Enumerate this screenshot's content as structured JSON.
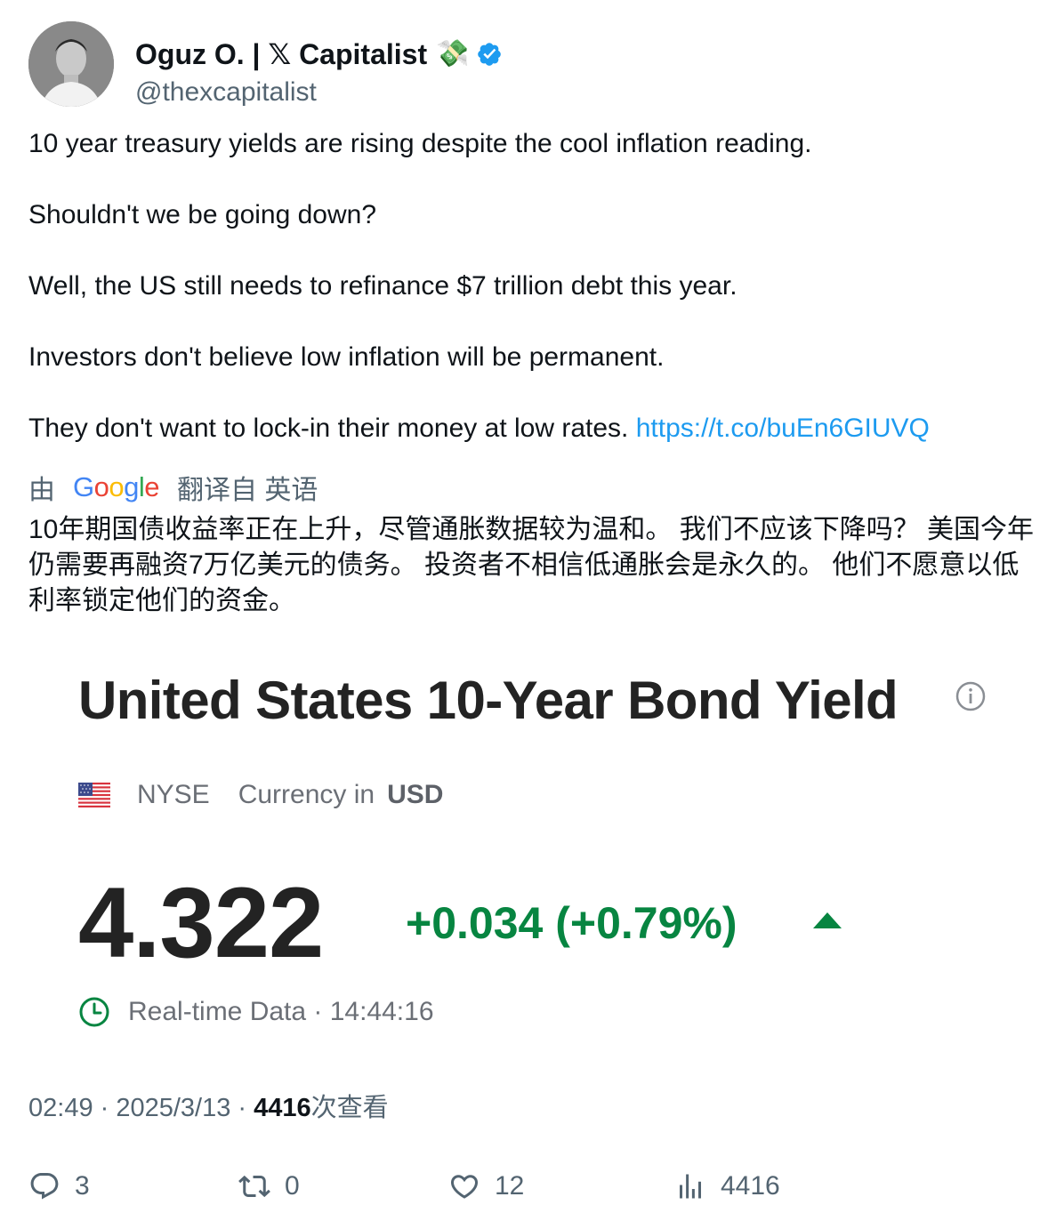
{
  "author": {
    "display_name": "Oguz O. | 𝕏 Capitalist",
    "emoji": "💸",
    "handle": "@thexcapitalist",
    "verified": true
  },
  "tweet": {
    "paragraphs": [
      "10 year treasury yields are rising despite the cool inflation reading.",
      "Shouldn't we be going down?",
      "Well, the US still needs to refinance $7 trillion debt this year.",
      "Investors don't believe low inflation will be permanent."
    ],
    "last_paragraph_text": "They don't want to lock-in their money at low rates.",
    "link": "https://t.co/buEn6GIUVQ"
  },
  "translation": {
    "prefix": "由",
    "provider": "Google",
    "suffix": "翻译自 英语",
    "text": "10年期国债收益率正在上升，尽管通胀数据较为温和。 我们不应该下降吗？ 美国今年仍需要再融资7万亿美元的债务。 投资者不相信低通胀会是永久的。 他们不愿意以低利率锁定他们的资金。"
  },
  "card": {
    "title": "United States 10-Year Bond Yield",
    "exchange": "NYSE",
    "currency_label": "Currency in",
    "currency": "USD",
    "price": "4.322",
    "change": "+0.034 (+0.79%)",
    "change_color": "#078541",
    "realtime_label": "Real-time Data · 14:44:16"
  },
  "meta": {
    "time_date": "02:49 · 2025/3/13 · ",
    "views_count": "4416",
    "views_label": "次查看"
  },
  "actions": {
    "replies": "3",
    "retweets": "0",
    "likes": "12",
    "views": "4416"
  },
  "colors": {
    "link": "#1d9bf0",
    "verified": "#1d9bf0",
    "secondary_text": "#536471"
  }
}
